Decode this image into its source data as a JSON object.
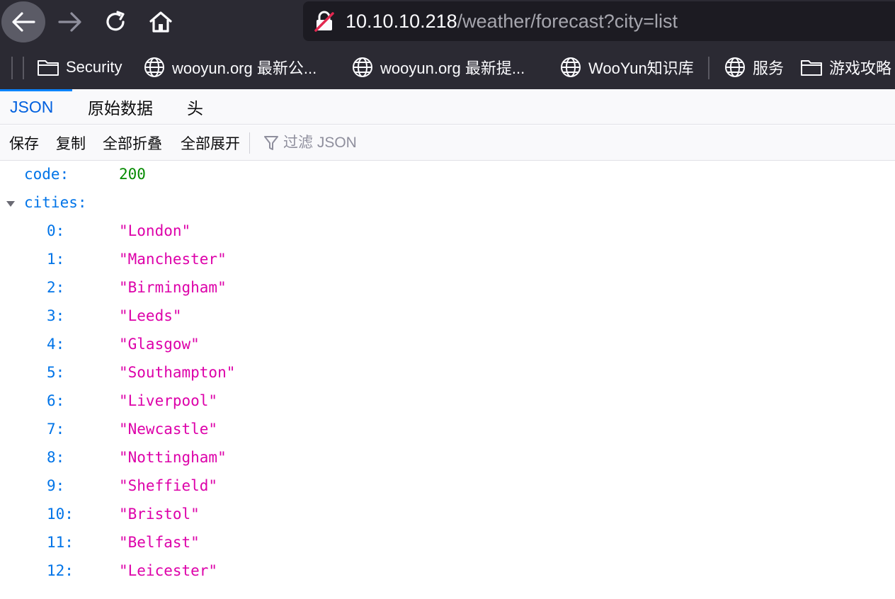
{
  "browser": {
    "url_host": "10.10.10.218",
    "url_path": "/weather/forecast?city=list",
    "icons": {
      "back": "arrow-left-icon",
      "forward": "arrow-right-icon",
      "reload": "reload-icon",
      "home": "home-icon",
      "lock": "insecure-lock-icon"
    }
  },
  "bookmarks": [
    {
      "label": "Security",
      "icon": "folder-icon"
    },
    {
      "label": "wooyun.org 最新公...",
      "icon": "globe-icon"
    },
    {
      "label": "wooyun.org 最新提...",
      "icon": "globe-icon"
    },
    {
      "label": "WooYun知识库",
      "icon": "globe-icon"
    },
    {
      "label": "服务",
      "icon": "globe-icon"
    },
    {
      "label": "游戏攻略",
      "icon": "folder-icon"
    }
  ],
  "viewer": {
    "tabs": [
      {
        "label": "JSON",
        "active": true
      },
      {
        "label": "原始数据",
        "active": false
      },
      {
        "label": "头",
        "active": false
      }
    ],
    "toolbar": {
      "save": "保存",
      "copy": "复制",
      "collapse_all": "全部折叠",
      "expand_all": "全部展开",
      "filter_placeholder": "过滤 JSON",
      "filter_icon": "filter-icon"
    },
    "json": {
      "code_key": "code:",
      "code_value": "200",
      "cities_key": "cities:",
      "cities": [
        {
          "index": "0:",
          "value": "\"London\""
        },
        {
          "index": "1:",
          "value": "\"Manchester\""
        },
        {
          "index": "2:",
          "value": "\"Birmingham\""
        },
        {
          "index": "3:",
          "value": "\"Leeds\""
        },
        {
          "index": "4:",
          "value": "\"Glasgow\""
        },
        {
          "index": "5:",
          "value": "\"Southampton\""
        },
        {
          "index": "6:",
          "value": "\"Liverpool\""
        },
        {
          "index": "7:",
          "value": "\"Newcastle\""
        },
        {
          "index": "8:",
          "value": "\"Nottingham\""
        },
        {
          "index": "9:",
          "value": "\"Sheffield\""
        },
        {
          "index": "10:",
          "value": "\"Bristol\""
        },
        {
          "index": "11:",
          "value": "\"Belfast\""
        },
        {
          "index": "12:",
          "value": "\"Leicester\""
        }
      ]
    }
  },
  "colors": {
    "key": "#0074e8",
    "number": "#058b00",
    "string": "#dd00a9",
    "chrome": "#2b2a33",
    "accent": "#0a84ff"
  }
}
